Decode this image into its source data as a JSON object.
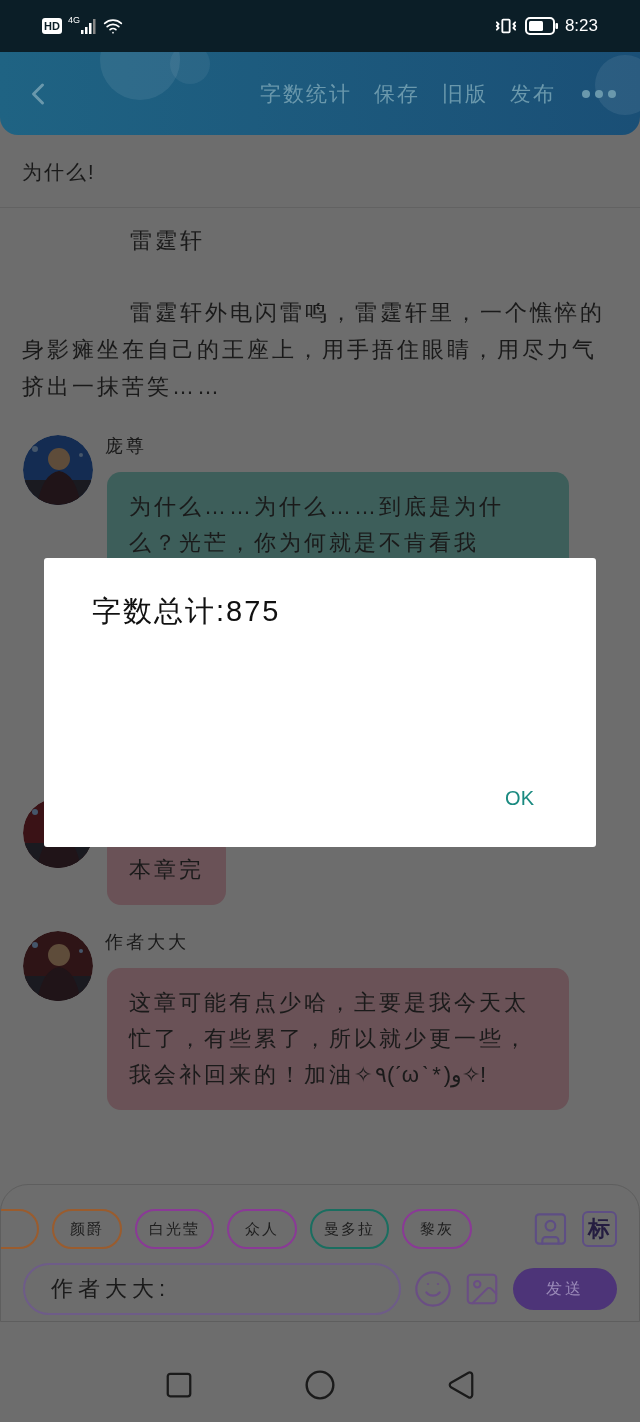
{
  "status_bar": {
    "hd": "HD",
    "network": "4G",
    "time": "8:23"
  },
  "header": {
    "actions": [
      "字数统计",
      "保存",
      "旧版",
      "发布"
    ]
  },
  "chapter_title": "为什么!",
  "article": [
    "雷霆轩",
    "雷霆轩外电闪雷鸣，雷霆轩里，一个憔悴的身影瘫坐在自己的王座上，用手捂住眼睛，用尽力气挤出一抹苦笑……"
  ],
  "messages": [
    {
      "name": "庞尊",
      "text": "为什么……为什么……到底是为什么？光芒，你为何就是不肯看我",
      "color": "#3d5e5a"
    },
    {
      "text": "本章完",
      "color": "#6a5257"
    },
    {
      "name": "作者大大",
      "text": "这章可能有点少哈，主要是我今天太忙了，有些累了，所以就少更一些，我会补回来的！加油✧٩(ˊωˋ*)و✧!",
      "color": "#6a5257"
    }
  ],
  "characters": [
    {
      "color": "#9a5c2e"
    },
    {
      "label": "颜爵",
      "color": "#9a5c2e"
    },
    {
      "label": "白光莹",
      "color": "#8a3a96"
    },
    {
      "label": "众人",
      "color": "#8a3a96"
    },
    {
      "label": "曼多拉",
      "color": "#1a6e60"
    },
    {
      "label": "黎灰",
      "color": "#8a3a96"
    }
  ],
  "mark_button": "标",
  "input": {
    "value": "作者大大:"
  },
  "send_button": "发送",
  "dialog": {
    "message": "字数总计:875",
    "ok": "OK"
  }
}
